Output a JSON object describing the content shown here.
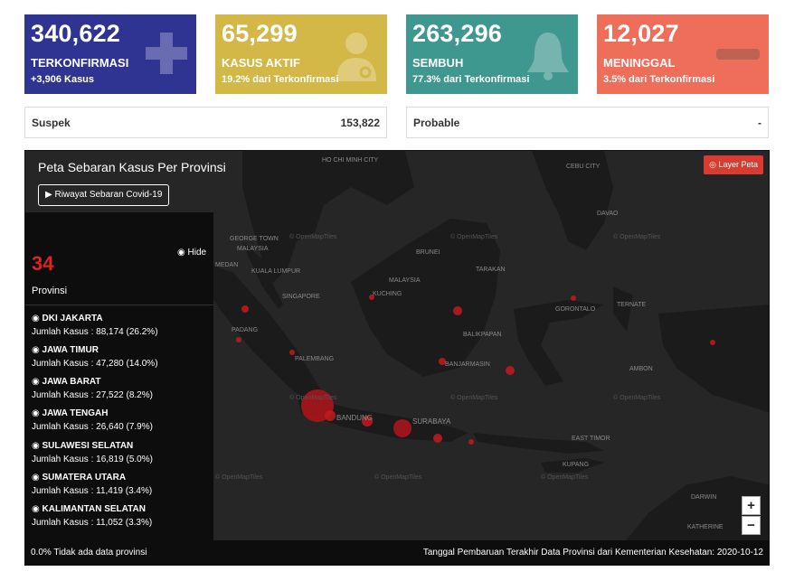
{
  "cards": {
    "confirmed": {
      "value": "340,622",
      "label": "TERKONFIRMASI",
      "sub": "+3,906 Kasus",
      "color": "#2f3392"
    },
    "active": {
      "value": "65,299",
      "label": "KASUS AKTIF",
      "sub": "19.2% dari Terkonfirmasi",
      "color": "#d3b747"
    },
    "recovered": {
      "value": "263,296",
      "label": "SEMBUH",
      "sub": "77.3% dari Terkonfirmasi",
      "color": "#3f9890"
    },
    "deaths": {
      "value": "12,027",
      "label": "MENINGGAL",
      "sub": "3.5% dari Terkonfirmasi",
      "color": "#ee6e59"
    }
  },
  "suspek": {
    "label": "Suspek",
    "value": "153,822"
  },
  "probable": {
    "label": "Probable",
    "value": "-"
  },
  "map": {
    "title": "Peta Sebaran Kasus Per Provinsi",
    "history_button": "Riwayat Sebaran Covid-19",
    "layer_button": "Layer Peta",
    "hide_label": "Hide",
    "province_count": "34",
    "province_count_label": "Provinsi",
    "provinces": [
      {
        "name": "DKI JAKARTA",
        "cases": "Jumlah Kasus : 88,174 (26.2%)"
      },
      {
        "name": "JAWA TIMUR",
        "cases": "Jumlah Kasus : 47,280 (14.0%)"
      },
      {
        "name": "JAWA BARAT",
        "cases": "Jumlah Kasus : 27,522 (8.2%)"
      },
      {
        "name": "JAWA TENGAH",
        "cases": "Jumlah Kasus : 26,640 (7.9%)"
      },
      {
        "name": "SULAWESI SELATAN",
        "cases": "Jumlah Kasus : 16,819 (5.0%)"
      },
      {
        "name": "SUMATERA UTARA",
        "cases": "Jumlah Kasus : 11,419 (3.4%)"
      },
      {
        "name": "KALIMANTAN SELATAN",
        "cases": "Jumlah Kasus : 11,052 (3.3%)"
      }
    ],
    "footer_left": "0.0% Tidak ada data provinsi",
    "footer_right": "Tanggal Pembaruan Terakhir Data Provinsi dari Kementerian Kesehatan: 2020-10-12",
    "zoom_in": "+",
    "zoom_out": "−",
    "tiles_credit": "© OpenMapTiles",
    "place_labels": {
      "ho_chi_minh": "HO CHI MINH CITY",
      "cebu": "CEBU CITY",
      "davao": "DAVAO",
      "george_town": "GEORGE TOWN",
      "malaysia_n": "MALAYSIA",
      "medan": "MEDAN",
      "kuala_lumpur": "KUALA LUMPUR",
      "singapore": "SINGAPORE",
      "brunei": "BRUNEI",
      "tarakan": "TARAKAN",
      "malaysia_e": "MALAYSIA",
      "kuching": "KUCHING",
      "gorontalo": "GORONTALO",
      "ternate": "TERNATE",
      "padang": "PADANG",
      "balikpapan": "BALIKPAPAN",
      "banjarmasin": "BANJARMASIN",
      "ambon": "AMBON",
      "palembang": "PALEMBANG",
      "bandung": "BANDUNG",
      "surabaya": "SURABAYA",
      "east_timor": "EAST TIMOR",
      "kupang": "KUPANG",
      "darwin": "DARWIN",
      "katherine": "KATHERINE"
    }
  }
}
